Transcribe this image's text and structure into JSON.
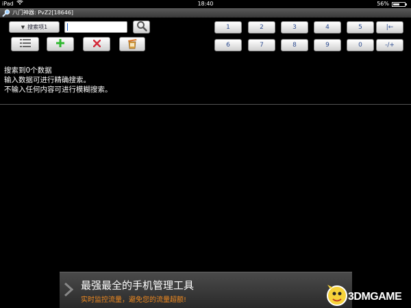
{
  "status_bar": {
    "device": "iPad",
    "time": "18:40",
    "battery": "56%",
    "battery_level": 0.56
  },
  "title_bar": {
    "title": "八门神器: PvZ2[18646]"
  },
  "toolbar": {
    "search_item_label": "搜索项1",
    "search_input_value": "",
    "icons": {
      "search": "magnifier-icon",
      "list": "list-icon",
      "add": "plus-icon",
      "delete": "x-icon",
      "clear": "trash-icon"
    }
  },
  "keypad": {
    "row1": [
      "1",
      "2",
      "3",
      "4",
      "5",
      "|←"
    ],
    "row2": [
      "6",
      "7",
      "8",
      "9",
      "0",
      "-/+"
    ]
  },
  "messages": [
    "搜索到0个数据",
    "输入数据可进行精确搜索。",
    "不输入任何内容可进行模糊搜索。"
  ],
  "banner": {
    "headline": "最强最全的手机管理工具",
    "subline": "实时监控流量，避免您的流量超额!"
  },
  "watermark": {
    "text": "3DMGAME"
  },
  "colors": {
    "key_text": "#2a4a90",
    "add_green": "#2fb82f",
    "delete_red": "#d42a3a",
    "banner_subline": "#f08a20"
  }
}
